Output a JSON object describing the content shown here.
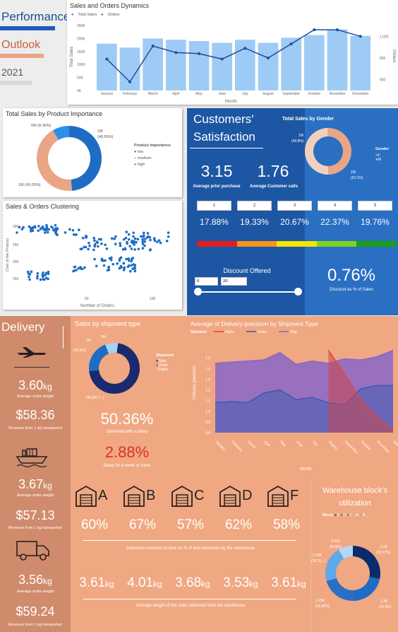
{
  "header": {
    "line1": "Performance",
    "line2": "Outlook",
    "line3": "2021"
  },
  "colors": {
    "bar_light": "#9ecbf5",
    "navy": "#1f4e9a",
    "blue": "#1f6cc4",
    "salmon": "#e9a585",
    "salmon_dark": "#d08b6c",
    "delivery_panel": "#f0a882"
  },
  "sales_orders": {
    "title": "Sales and Orders Dynamics",
    "legend_sales": "Total Sales",
    "legend_orders": "Orders",
    "ylabel_left": "Total Sales",
    "ylabel_right": "Orders",
    "xlabel": "Month",
    "y_ticks_left": [
      "250K",
      "200K",
      "150K",
      "100K",
      "50K",
      "0K"
    ],
    "y_ticks_right": [
      "1,000",
      "800",
      "600"
    ]
  },
  "chart_data": [
    {
      "type": "bar",
      "title": "Sales and Orders Dynamics",
      "xlabel": "Month",
      "ylabel": "Total Sales",
      "categories": [
        "January",
        "February",
        "March",
        "April",
        "May",
        "June",
        "July",
        "August",
        "September",
        "October",
        "November",
        "December"
      ],
      "ylim": [
        0,
        250000
      ],
      "series": [
        {
          "name": "Total Sales",
          "values": [
            180000,
            165000,
            200000,
            195000,
            190000,
            183000,
            195000,
            183000,
            203000,
            213000,
            235000,
            210000
          ]
        },
        {
          "name": "Orders",
          "axis": "right",
          "ylim": [
            500,
            1100
          ],
          "values": [
            790,
            580,
            910,
            850,
            840,
            790,
            890,
            800,
            930,
            1060,
            1060,
            1000
          ]
        }
      ]
    },
    {
      "type": "pie",
      "title": "Total Sales by Product Importance",
      "legend_title": "Product importance",
      "categories": [
        "low",
        "medium",
        "high"
      ],
      "values": [
        48.59,
        43.05,
        8.36
      ],
      "labels": [
        "1M (48.59%)",
        "1M (43.05%)",
        "0M (8.36%)"
      ]
    },
    {
      "type": "scatter",
      "title": "Sales & Orders Clustering",
      "xlabel": "Number of Orders",
      "ylabel": "Cost of the Product",
      "x_ticks": [
        "50",
        "100"
      ],
      "y_ticks": [
        "300",
        "250",
        "200",
        "150"
      ]
    },
    {
      "type": "pie",
      "title": "Total Sales by Gender",
      "legend_title": "Gender",
      "categories": [
        "F",
        "M"
      ],
      "values": [
        49.8,
        50.1
      ],
      "labels": [
        "1M (49.8%)",
        "1M (50.1%)"
      ]
    },
    {
      "type": "pie",
      "title": "Sales by shipment type",
      "legend_title": "Shipment",
      "categories": [
        "Ship",
        "Road",
        "Flight"
      ],
      "values": [
        69.7,
        20.6,
        8.0
      ],
      "labels": [
        "2M (69.7%)",
        "1M (20.6%)",
        "0M"
      ]
    },
    {
      "type": "area",
      "title": "Average of Delivery precision by Shipment Type",
      "xlabel": "Month",
      "ylabel": "Delivery precision",
      "legend_title": "Shipment",
      "categories": [
        "January",
        "February",
        "March",
        "April",
        "May",
        "June",
        "July",
        "August",
        "September",
        "October",
        "November",
        "December"
      ],
      "ylim": [
        0.8,
        1.6
      ],
      "y_ticks": [
        "1.5",
        "1.4",
        "1.3",
        "1.2",
        "1.1",
        "1.0",
        "0.9",
        "0.8"
      ],
      "series": [
        {
          "name": "Flight",
          "values": [
            null,
            null,
            null,
            null,
            null,
            null,
            null,
            1.57,
            1.35,
            1.1,
            0.95,
            0.82
          ]
        },
        {
          "name": "Road",
          "values": [
            1.08,
            1.09,
            1.08,
            1.17,
            1.2,
            1.11,
            1.13,
            1.08,
            1.06,
            1.21,
            1.24,
            1.24
          ]
        },
        {
          "name": "Ship",
          "values": [
            1.45,
            1.46,
            1.47,
            1.48,
            1.55,
            1.44,
            1.47,
            1.45,
            1.49,
            1.48,
            1.51,
            1.57
          ]
        }
      ]
    },
    {
      "type": "pie",
      "title": "Warehouse block's utilization",
      "legend_title": "Block",
      "categories": [
        "F",
        "D",
        "C",
        "B",
        "A"
      ],
      "values": [
        28.17,
        21.0,
        20.86,
        20.76,
        8.62
      ],
      "labels": [
        "3.1K (28.17%)",
        "2.3K (21.0%)",
        "2.29K (20.86%)",
        "2.28K (20.76...)",
        "0.95K (8.62%)"
      ]
    }
  ],
  "importance": {
    "title": "Total Sales by Product Importance",
    "label_low": "1M",
    "label_low_pct": "(48.59%)",
    "label_medium": "1M (43.05%)",
    "label_high": "0M (8.36%)",
    "legend_title": "Product importance",
    "legend": [
      "low",
      "medium",
      "high"
    ]
  },
  "clustering": {
    "title": "Sales & Orders Clustering",
    "xlabel": "Number of Orders",
    "ylabel": "Cost of the Product",
    "x_ticks": [
      "50",
      "100"
    ],
    "y_ticks": [
      "300",
      "250",
      "200",
      "150"
    ]
  },
  "customers": {
    "title_line1": "Customers'",
    "title_line2": "Satisfaction",
    "prior_value": "3.15",
    "prior_label": "Average prior purchase",
    "calls_value": "1.76",
    "calls_label": "Average Customer calls",
    "ratings": [
      "1",
      "2",
      "3",
      "4",
      "5"
    ],
    "rating_pcts": [
      "17.88%",
      "19.33%",
      "20.67%",
      "22.37%",
      "19.76%"
    ],
    "rating_colors": [
      "#e02020",
      "#f7941d",
      "#f2e500",
      "#7ed321",
      "#1a9e1a"
    ],
    "discount_title": "Discount Offered",
    "discount_min": "0",
    "discount_max": "20",
    "discount_pct": "0.76%",
    "discount_pct_label": "Discount as % of Sales"
  },
  "gender": {
    "title": "Total Sales by Gender",
    "label_f": "1M",
    "label_f_pct": "(49.8%)",
    "label_m": "1M",
    "label_m_pct": "(50.1%)",
    "legend_title": "Gender",
    "legend": [
      "F",
      "M"
    ]
  },
  "delivery": {
    "title": "Delivery",
    "items": [
      {
        "weight": "3.60",
        "unit": "kg",
        "weight_label": "Average order weight",
        "revenue": "$58.36",
        "revenue_label": "Revenue from 1 kg transported",
        "icon": "airplane-icon"
      },
      {
        "weight": "3.67",
        "unit": "kg",
        "weight_label": "Average order weight",
        "revenue": "$57.13",
        "revenue_label": "Revenue from 1 kg transported",
        "icon": "ship-icon"
      },
      {
        "weight": "3.56",
        "unit": "kg",
        "weight_label": "Average order weight",
        "revenue": "$59.24",
        "revenue_label": "Revenue from 1 kg transported",
        "icon": "truck-icon"
      }
    ]
  },
  "shipment": {
    "title": "Sales by shipment type",
    "label_flight": "0M",
    "label_road": "1M",
    "label_road_pct": "(20.6%)",
    "label_ship": "2M (69.7...)",
    "legend_title": "Shipment",
    "legend": [
      "Ship",
      "Road",
      "Flight"
    ],
    "delay_pct": "50.36%",
    "delay_label": "Delivered with a delay",
    "week_pct": "2.88%",
    "week_label": "Delay for a week or more"
  },
  "precision": {
    "title": "Average of Delivery precision by Shipment Type",
    "legend_title": "Shipment",
    "legend": [
      "Flight",
      "Road",
      "Ship"
    ],
    "ylabel": "Delivery precision",
    "xlabel": "Month",
    "y_ticks": [
      "1.5",
      "1.4",
      "1.3",
      "1.2",
      "1.1",
      "1.0",
      "0.9",
      "0.8"
    ]
  },
  "warehouses": {
    "letters": [
      "A",
      "B",
      "C",
      "D",
      "F"
    ],
    "ontime": [
      "60%",
      "67%",
      "57%",
      "62%",
      "58%"
    ],
    "ontime_label": "Deliveries reached on time as % of total deliveries by the warehouse",
    "weights": [
      "3.61",
      "4.01",
      "3.68",
      "3.53",
      "3.61"
    ],
    "unit": "kg",
    "weight_label": "Average weight of the order delivered from the warehouse"
  },
  "utilization": {
    "title_line1": "Warehouse block's",
    "title_line2": "utilization",
    "legend_title": "Block",
    "legend": [
      "F",
      "D",
      "C",
      "A",
      "B"
    ],
    "label_a": "0.95K",
    "label_a_pct": "(8.62%)",
    "label_b": "2.28K",
    "label_b_pct": "(20.76...)",
    "label_c": "2.29K",
    "label_c_pct": "(20.86%)",
    "label_d": "2.3K",
    "label_d_pct": "(21.0%)",
    "label_f": "3.1K",
    "label_f_pct": "(28.17%)"
  }
}
